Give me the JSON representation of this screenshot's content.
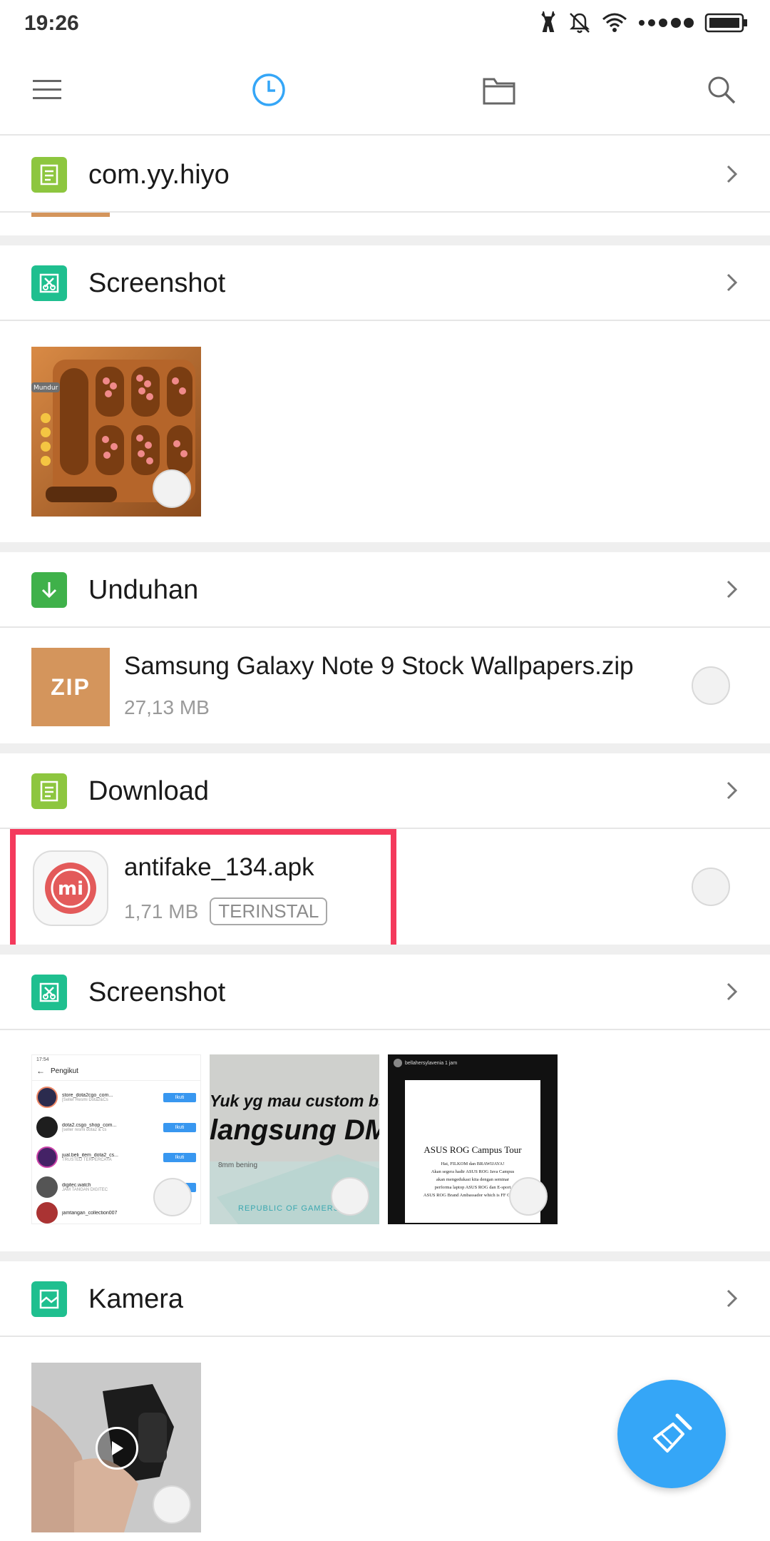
{
  "status_bar": {
    "time": "19:26"
  },
  "toolbar": {
    "menu_icon": "menu-icon",
    "recent_icon": "clock-icon",
    "folder_icon": "folder-icon",
    "search_icon": "search-icon",
    "accent": "#35a6f7"
  },
  "sections": [
    {
      "title": "com.yy.hiyo",
      "icon": "document-icon",
      "icon_color": "#8dc63f"
    },
    {
      "title": "Screenshot",
      "icon": "scissors-icon",
      "icon_color": "#1fbf8f"
    },
    {
      "title": "Unduhan",
      "icon": "download-arrow-icon",
      "icon_color": "#3fb14a"
    },
    {
      "title": "Download",
      "icon": "document-icon",
      "icon_color": "#8dc63f"
    },
    {
      "title": "Screenshot",
      "icon": "scissors-icon",
      "icon_color": "#1fbf8f"
    },
    {
      "title": "Kamera",
      "icon": "image-icon",
      "icon_color": "#1fbf8f"
    }
  ],
  "files": {
    "zip": {
      "name": "Samsung Galaxy Note 9 Stock Wallpapers.zip",
      "size": "27,13 MB",
      "icon_label": "ZIP"
    },
    "apk": {
      "name": "antifake_134.apk",
      "size": "1,71 MB",
      "badge": "TERINSTAL",
      "icon_label": "mi"
    }
  },
  "thumbnails": {
    "game": {
      "label": "Mundur"
    },
    "follow_list": {
      "time": "17:54",
      "title": "Pengikut",
      "rows": [
        {
          "name": "store_dota2cgo_com...",
          "sub": "[Seller Resmi Dota2&Cs",
          "button": "Ikuti"
        },
        {
          "name": "dota2.csgo_shop_com...",
          "sub": "[seller resmi dota2 & cs",
          "button": "Ikuti"
        },
        {
          "name": "jual.beli_item_dota2_cs...",
          "sub": "TRUSTED TERPERCAYA",
          "button": "Ikuti"
        },
        {
          "name": "digitec.watch",
          "sub": "JAM TANGAN DIGITEC",
          "button": "Ikuti"
        },
        {
          "name": "jamtangan_collection007",
          "sub": "",
          "button": ""
        }
      ]
    },
    "story": {
      "line1": "Yuk yg mau custom bsa",
      "line2": "langsung DM",
      "small": "8mm bening",
      "brand": "REPUBLIC OF GAMERS"
    },
    "poster": {
      "header": "bellahersylavenia 1 jam",
      "title": "ASUS ROG Campus Tour",
      "lines": [
        "Hai, FILKOM dan BRAWIJAYA!",
        "Akan segera hadir ASUS ROG Java Campus",
        "akan mengedukasi kita dengan seminar",
        "performa laptop ASUS ROG dan E-sport",
        "ASUS ROG Brand Ambassador which is FF Gaming"
      ]
    }
  },
  "fab": {
    "icon": "broom-icon"
  }
}
